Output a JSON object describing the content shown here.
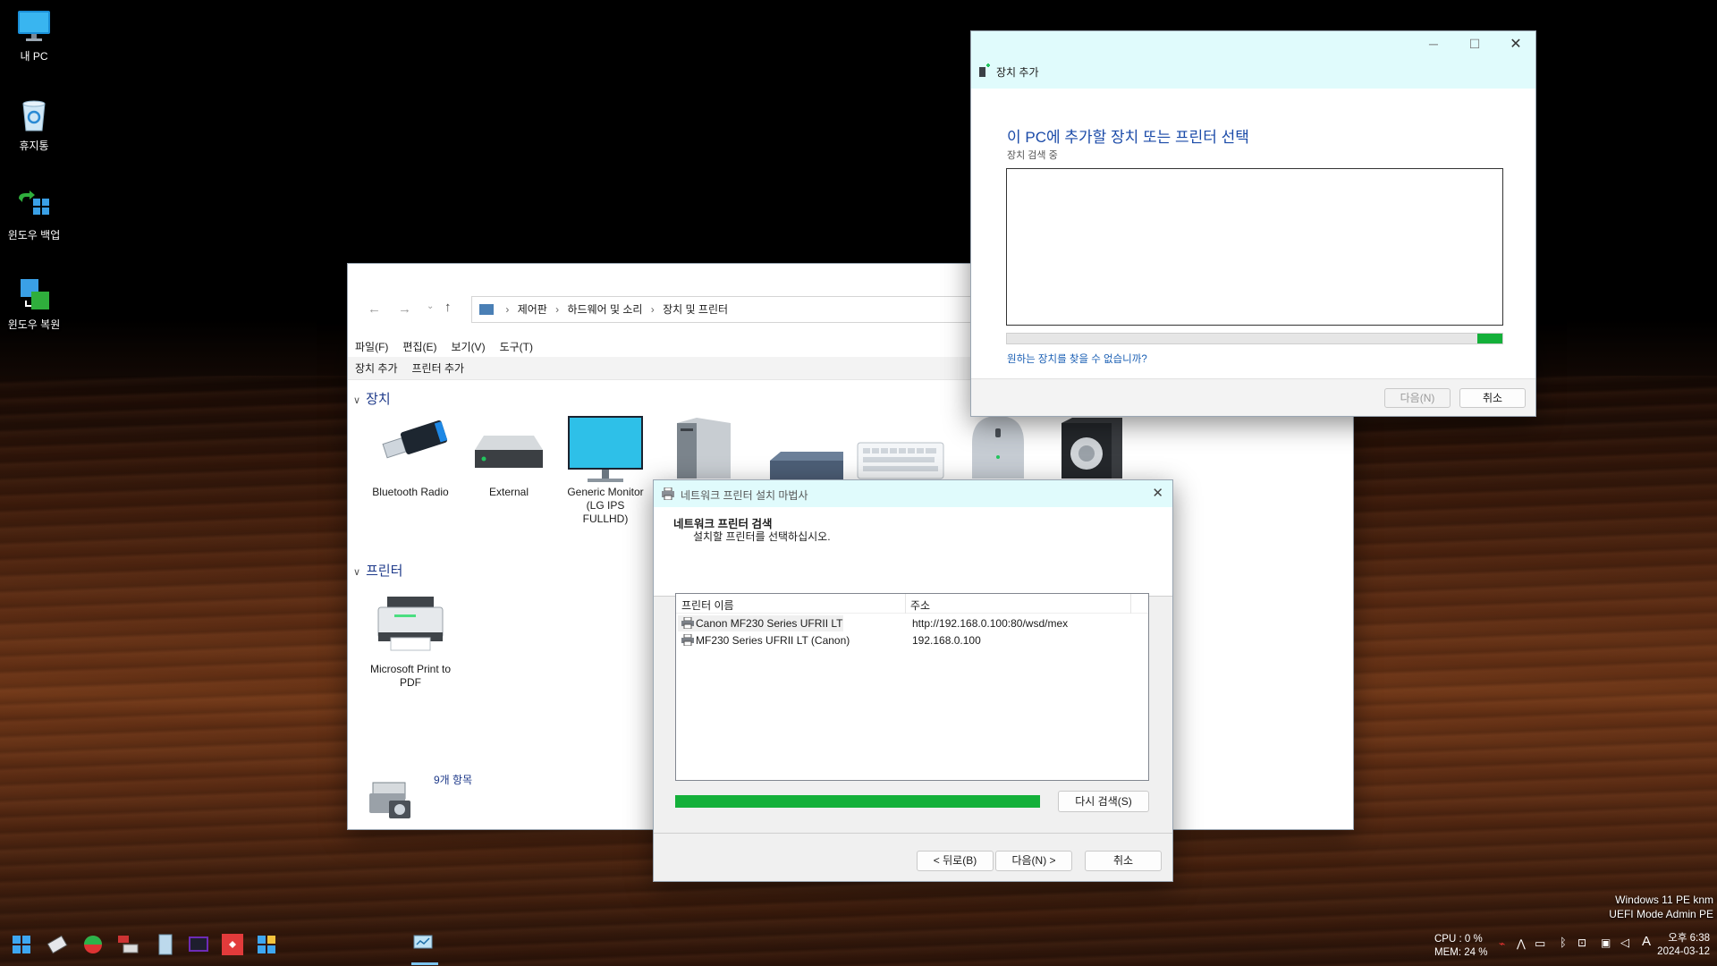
{
  "desktop": {
    "icons": [
      {
        "label": "내 PC"
      },
      {
        "label": "휴지통"
      },
      {
        "label": "윈도우 백업"
      },
      {
        "label": "윈도우 복원"
      }
    ],
    "watermark": {
      "line1": "Windows 11 PE knm",
      "line2": "UEFI Mode Admin PE"
    }
  },
  "control_panel": {
    "breadcrumb": [
      "제어판",
      "하드웨어 및 소리",
      "장치 및 프린터"
    ],
    "menu": [
      "파일(F)",
      "편집(E)",
      "보기(V)",
      "도구(T)"
    ],
    "commands": [
      "장치 추가",
      "프린터 추가"
    ],
    "devices_group": "장치",
    "devices": [
      {
        "name": "Bluetooth Radio"
      },
      {
        "name": "External"
      },
      {
        "name": "Generic Monitor (LG IPS FULLHD)"
      }
    ],
    "printers_group": "프린터",
    "printers": [
      {
        "name": "Microsoft Print to PDF"
      }
    ],
    "item_count": "9개 항목"
  },
  "add_device": {
    "title": "장치 추가",
    "heading": "이 PC에 추가할 장치 또는 프린터 선택",
    "status": "장치 검색 중",
    "help_link": "원하는 장치를 찾을 수 없습니까?",
    "next_label": "다음(N)",
    "cancel_label": "취소",
    "progress": 0.05
  },
  "printer_wizard": {
    "title": "네트워크 프린터 설치 마법사",
    "heading": "네트워크 프린터 검색",
    "subheading": "설치할 프린터를 선택하십시오.",
    "columns": [
      "프린터 이름",
      "주소"
    ],
    "rows": [
      {
        "name": "Canon MF230 Series UFRII LT",
        "address": "http://192.168.0.100:80/wsd/mex"
      },
      {
        "name": "MF230 Series UFRII LT (Canon)",
        "address": "192.168.0.100"
      }
    ],
    "progress": 1.0,
    "research_label": "다시 검색(S)",
    "back_label": "< 뒤로(B)",
    "next_label": "다음(N) >",
    "cancel_label": "취소"
  },
  "taskbar": {
    "cpu": "CPU :   0 %",
    "mem": "MEM: 24 %",
    "time": "오후 6:38",
    "date": "2024-03-12",
    "ime": "A"
  },
  "colors": {
    "accent_green": "#14b03a",
    "link_blue": "#1a5fb4",
    "title_cyan": "#e0fbfc"
  }
}
